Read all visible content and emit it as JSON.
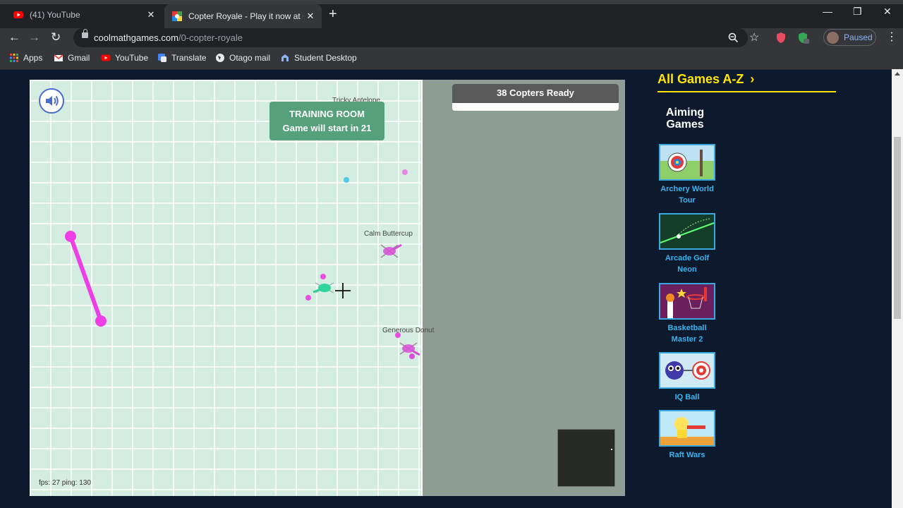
{
  "browser": {
    "tabs": [
      {
        "title": "(41) YouTube"
      },
      {
        "title": "Copter Royale - Play it now at Coolmath Games"
      }
    ],
    "url_host": "coolmathgames.com",
    "url_path": "/0-copter-royale",
    "profile_label": "Paused",
    "bookmarks": [
      "Apps",
      "Gmail",
      "YouTube",
      "Translate",
      "Otago mail",
      "Student Desktop"
    ]
  },
  "game": {
    "training_title": "TRAINING ROOM",
    "countdown_text": "Game will start in 21",
    "copters_ready": "38 Copters Ready",
    "players": [
      "Tricky Antelope",
      "Calm Buttercup",
      "Generous Donut"
    ],
    "stats": "fps: 27 ping: 130",
    "colors": {
      "arena": "#d5ece1",
      "player": "#2fd3a0",
      "enemy": "#d94fd6",
      "banner": "#56a07a"
    }
  },
  "sidebar": {
    "title": "All Games A-Z",
    "heading": "Aiming Games",
    "games": [
      {
        "title": "Archery World Tour"
      },
      {
        "title": "Arcade Golf Neon"
      },
      {
        "title": "Basketball Master 2"
      },
      {
        "title": "IQ Ball"
      },
      {
        "title": "Raft Wars"
      }
    ]
  }
}
